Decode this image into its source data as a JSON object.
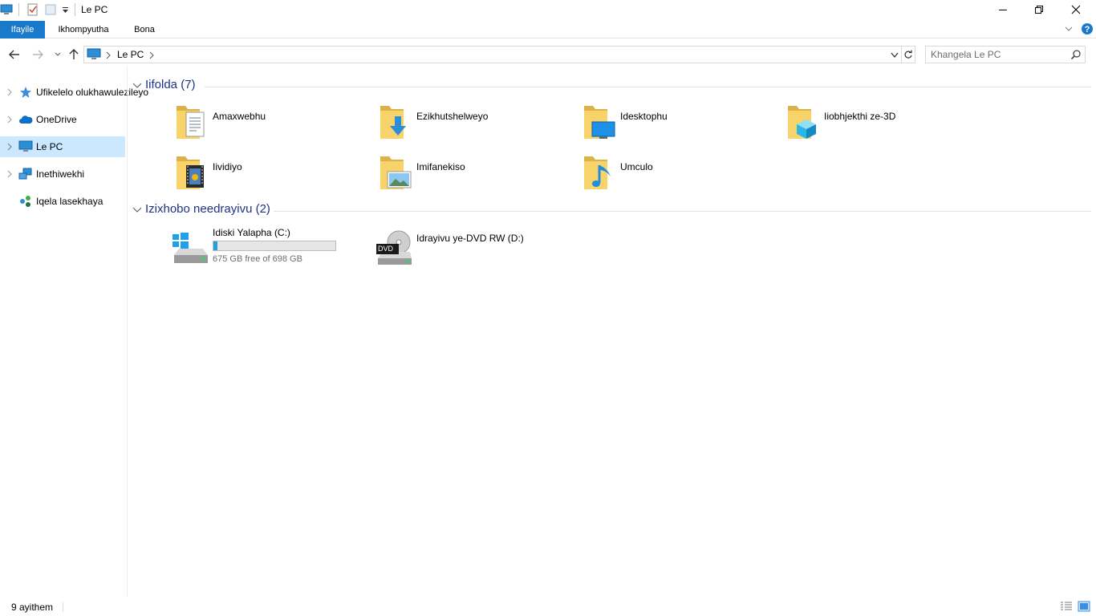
{
  "window": {
    "title": "Le PC",
    "controls": [
      "minimize-icon",
      "restore-icon",
      "close-icon"
    ]
  },
  "ribbon": {
    "tabs": [
      {
        "label": "Ifayile",
        "active": true
      },
      {
        "label": "Ikhompyutha",
        "active": false
      },
      {
        "label": "Bona",
        "active": false
      }
    ],
    "accent": "#1979ca"
  },
  "address": {
    "segments": [
      "Le PC"
    ],
    "search_placeholder": "Khangela Le PC"
  },
  "sidebar": {
    "items": [
      {
        "label": "Ufikelelo olukhawulezileyo",
        "icon": "star-icon"
      },
      {
        "label": "OneDrive",
        "icon": "cloud-icon"
      },
      {
        "label": "Le PC",
        "icon": "computer-icon",
        "selected": true
      },
      {
        "label": "Inethiwekhi",
        "icon": "network-icon"
      },
      {
        "label": "Iqela lasekhaya",
        "icon": "homegroup-icon"
      }
    ]
  },
  "groups": {
    "folders": {
      "title": "Iifolda (7)",
      "items": [
        {
          "label": "Amaxwebhu",
          "icon": "documents-folder-icon"
        },
        {
          "label": "Ezikhutshelweyo",
          "icon": "downloads-folder-icon"
        },
        {
          "label": "Idesktophu",
          "icon": "desktop-folder-icon"
        },
        {
          "label": "Iiobhjekthi ze-3D",
          "icon": "3d-objects-folder-icon"
        },
        {
          "label": "Iividiyo",
          "icon": "videos-folder-icon"
        },
        {
          "label": "Imifanekiso",
          "icon": "pictures-folder-icon"
        },
        {
          "label": "Umculo",
          "icon": "music-folder-icon"
        }
      ]
    },
    "drives": {
      "title": "Izixhobo needrayivu (2)",
      "items": [
        {
          "label": "Idiski Yalapha (C:)",
          "icon": "local-disk-icon",
          "free_text": "675 GB free of 698 GB",
          "used_fraction": 0.033
        },
        {
          "label": "Idrayivu ye-DVD RW (D:)",
          "icon": "dvd-drive-icon",
          "badge": "DVD"
        }
      ]
    }
  },
  "status": {
    "item_count": "9 ayithem"
  }
}
